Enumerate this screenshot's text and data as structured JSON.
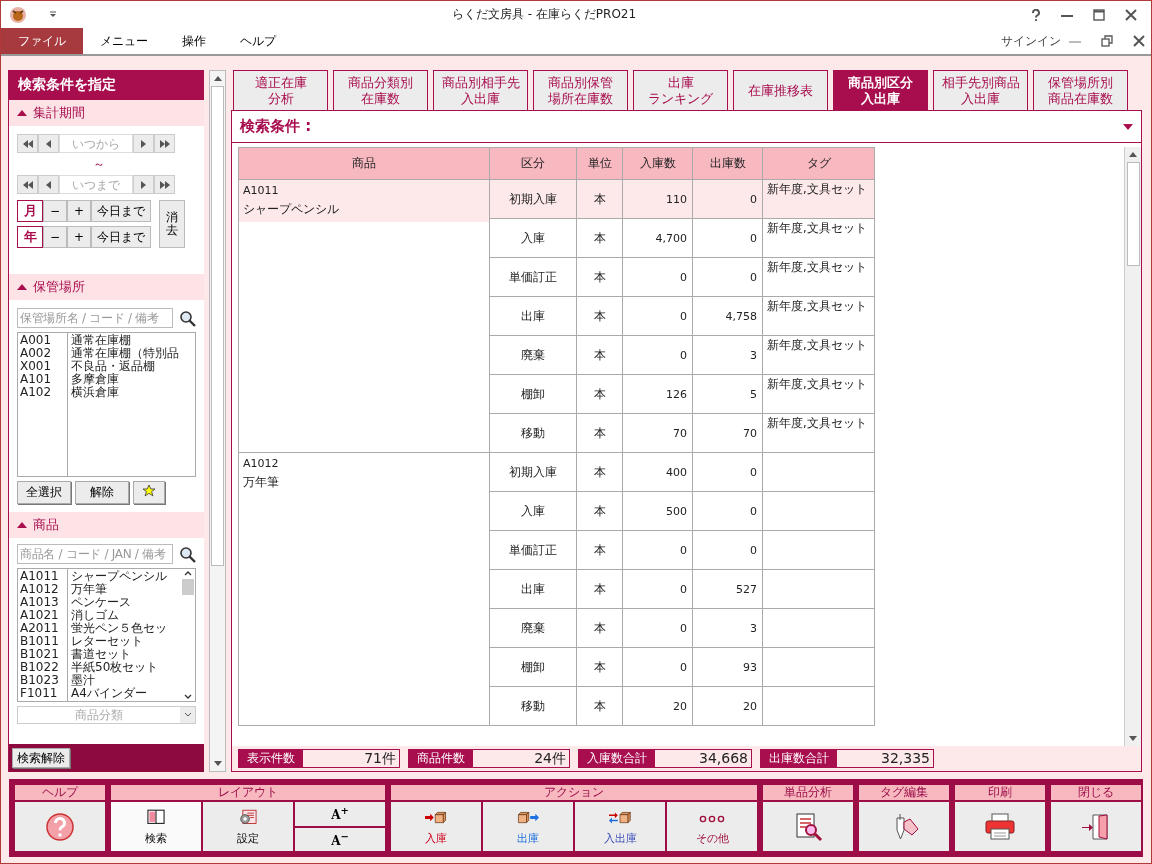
{
  "window": {
    "title": "らくだ文房具 - 在庫らくだPRO21"
  },
  "menu": {
    "items": [
      {
        "label": "ファイル",
        "selected": true
      },
      {
        "label": "メニュー",
        "selected": false
      },
      {
        "label": "操作",
        "selected": false
      },
      {
        "label": "ヘルプ",
        "selected": false
      }
    ],
    "signin": "サインイン"
  },
  "search_panel": {
    "title": "検索条件を指定",
    "period": {
      "title": "集計期間",
      "from_placeholder": "いつから",
      "separator": "～",
      "to_placeholder": "いつまで",
      "minus": "−",
      "plus": "+",
      "units": [
        {
          "label": "月",
          "today": "今日まで"
        },
        {
          "label": "年",
          "today": "今日まで"
        }
      ],
      "clear": "消去"
    },
    "locations": {
      "title": "保管場所",
      "placeholder": "保管場所名 / コード / 備考",
      "items": [
        {
          "code": "A001",
          "name": "通常在庫棚"
        },
        {
          "code": "A002",
          "name": "通常在庫棚（特別品"
        },
        {
          "code": "X001",
          "name": "不良品・返品棚"
        },
        {
          "code": "A101",
          "name": "多摩倉庫"
        },
        {
          "code": "A102",
          "name": "横浜倉庫"
        }
      ],
      "buttons": [
        "全選択",
        "解除"
      ]
    },
    "products": {
      "title": "商品",
      "placeholder": "商品名 / コード / JAN / 備考",
      "items": [
        {
          "code": "A1011",
          "name": "シャープペンシル"
        },
        {
          "code": "A1012",
          "name": "万年筆"
        },
        {
          "code": "A1013",
          "name": "ペンケース"
        },
        {
          "code": "A1021",
          "name": "消しゴム"
        },
        {
          "code": "A2011",
          "name": "蛍光ペン５色セッ"
        },
        {
          "code": "B1011",
          "name": "レターセット"
        },
        {
          "code": "B1021",
          "name": "書道セット"
        },
        {
          "code": "B1022",
          "name": "半紙50枚セット"
        },
        {
          "code": "B1023",
          "name": "墨汁"
        },
        {
          "code": "F1011",
          "name": "A4バインダー"
        }
      ],
      "category_placeholder": "商品分類"
    },
    "reset_button": "検索解除"
  },
  "tabs": [
    {
      "lines": [
        "適正在庫",
        "分析"
      ],
      "selected": false
    },
    {
      "lines": [
        "商品分類別",
        "在庫数"
      ],
      "selected": false
    },
    {
      "lines": [
        "商品別相手先",
        "入出庫"
      ],
      "selected": false
    },
    {
      "lines": [
        "商品別保管",
        "場所在庫数"
      ],
      "selected": false
    },
    {
      "lines": [
        "出庫",
        "ランキング"
      ],
      "selected": false
    },
    {
      "lines": [
        "在庫推移表"
      ],
      "selected": false
    },
    {
      "lines": [
        "商品別区分",
        "入出庫"
      ],
      "selected": true
    },
    {
      "lines": [
        "相手先別商品",
        "入出庫"
      ],
      "selected": false
    },
    {
      "lines": [
        "保管場所別",
        "商品在庫数"
      ],
      "selected": false
    }
  ],
  "conditions": {
    "label": "検索条件 :"
  },
  "table": {
    "columns": [
      "商品",
      "区分",
      "単位",
      "入庫数",
      "出庫数",
      "タグ"
    ],
    "products": [
      {
        "code": "A1011",
        "name": "シャープペンシル",
        "rows": [
          {
            "category": "初期入庫",
            "unit": "本",
            "in": "110",
            "out": "0",
            "tag": "新年度,文具セット",
            "selected": true
          },
          {
            "category": "入庫",
            "unit": "本",
            "in": "4,700",
            "out": "0",
            "tag": "新年度,文具セット",
            "selected": false
          },
          {
            "category": "単価訂正",
            "unit": "本",
            "in": "0",
            "out": "0",
            "tag": "新年度,文具セット",
            "selected": false
          },
          {
            "category": "出庫",
            "unit": "本",
            "in": "0",
            "out": "4,758",
            "tag": "新年度,文具セット",
            "selected": false
          },
          {
            "category": "廃棄",
            "unit": "本",
            "in": "0",
            "out": "3",
            "tag": "新年度,文具セット",
            "selected": false
          },
          {
            "category": "棚卸",
            "unit": "本",
            "in": "126",
            "out": "5",
            "tag": "新年度,文具セット",
            "selected": false
          },
          {
            "category": "移動",
            "unit": "本",
            "in": "70",
            "out": "70",
            "tag": "新年度,文具セット",
            "selected": false
          }
        ]
      },
      {
        "code": "A1012",
        "name": "万年筆",
        "rows": [
          {
            "category": "初期入庫",
            "unit": "本",
            "in": "400",
            "out": "0",
            "selected": false
          },
          {
            "category": "入庫",
            "unit": "本",
            "in": "500",
            "out": "0",
            "selected": false
          },
          {
            "category": "単価訂正",
            "unit": "本",
            "in": "0",
            "out": "0",
            "selected": false
          },
          {
            "category": "出庫",
            "unit": "本",
            "in": "0",
            "out": "527",
            "selected": false
          },
          {
            "category": "廃棄",
            "unit": "本",
            "in": "0",
            "out": "3",
            "selected": false
          },
          {
            "category": "棚卸",
            "unit": "本",
            "in": "0",
            "out": "93",
            "selected": false
          },
          {
            "category": "移動",
            "unit": "本",
            "in": "20",
            "out": "20",
            "selected": false
          }
        ]
      }
    ]
  },
  "summary": [
    {
      "label": "表示件数",
      "value": "71件"
    },
    {
      "label": "商品件数",
      "value": "24件"
    },
    {
      "label": "入庫数合計",
      "value": "34,668"
    },
    {
      "label": "出庫数合計",
      "value": "32,335"
    }
  ],
  "toolbar": {
    "groups": [
      {
        "label": "ヘルプ",
        "buttons": [
          {
            "kind": "help"
          }
        ]
      },
      {
        "label": "レイアウト",
        "buttons": [
          {
            "kind": "search",
            "label": "検索",
            "selected": true
          },
          {
            "kind": "settings",
            "label": "設定",
            "selected": false
          },
          {
            "kind": "font-size",
            "increase": "A$^{+}$",
            "decrease": "A$^{−}$"
          }
        ]
      },
      {
        "label": "アクション",
        "buttons": [
          {
            "kind": "in",
            "label": "入庫"
          },
          {
            "kind": "out",
            "label": "出庫"
          },
          {
            "kind": "inout",
            "label": "入出庫"
          },
          {
            "kind": "other",
            "label": "その他"
          }
        ]
      },
      {
        "label": "単品分析",
        "buttons": [
          {
            "kind": "analysis"
          }
        ]
      },
      {
        "label": "タグ編集",
        "buttons": [
          {
            "kind": "tag"
          }
        ]
      },
      {
        "label": "印刷",
        "buttons": [
          {
            "kind": "print"
          }
        ]
      },
      {
        "label": "閉じる",
        "buttons": [
          {
            "kind": "close"
          }
        ]
      }
    ]
  }
}
